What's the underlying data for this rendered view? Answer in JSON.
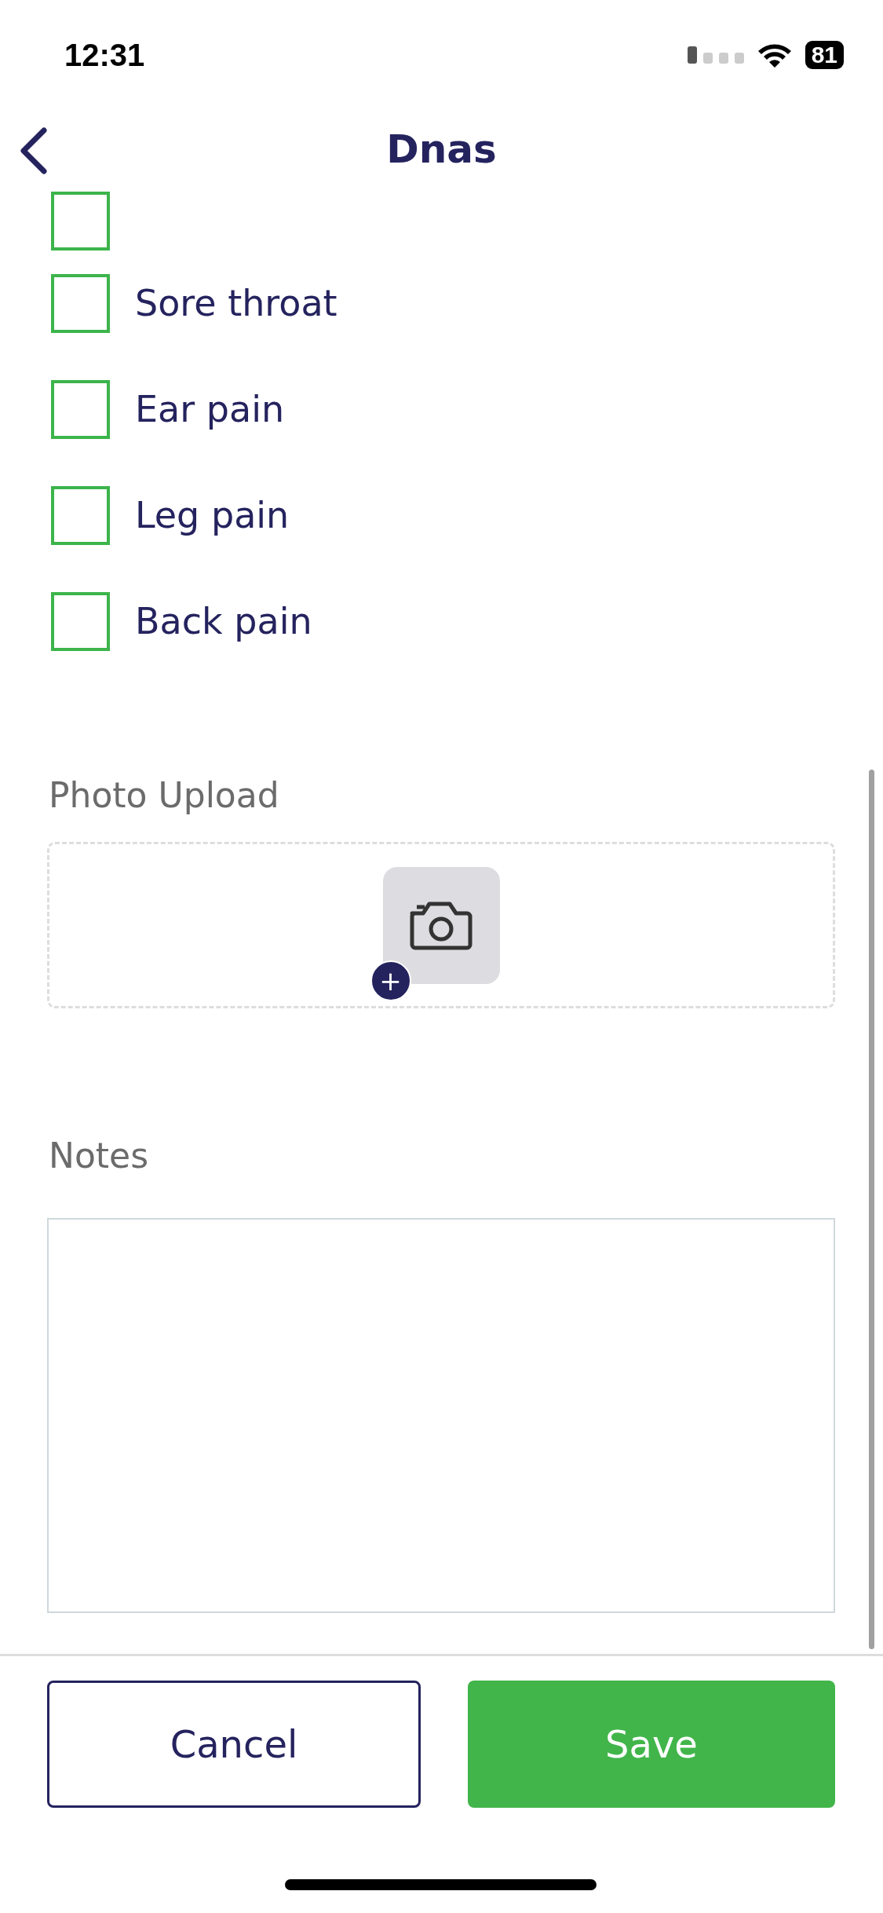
{
  "status_bar": {
    "time": "12:31",
    "battery": "81"
  },
  "header": {
    "title": "Dnas"
  },
  "symptoms": [
    {
      "kind": "partial",
      "checked": false
    },
    {
      "kind": "full",
      "label": "Sore throat",
      "checked": false
    },
    {
      "kind": "full",
      "label": "Ear pain",
      "checked": false
    },
    {
      "kind": "full",
      "label": "Leg pain",
      "checked": false
    },
    {
      "kind": "full",
      "label": "Back pain",
      "checked": false
    }
  ],
  "photo_upload": {
    "label": "Photo Upload",
    "add_symbol": "+"
  },
  "notes": {
    "label": "Notes"
  },
  "buttons": [
    {
      "kind": "secondary",
      "label": "Cancel"
    },
    {
      "kind": "primary",
      "label": "Save"
    }
  ]
}
